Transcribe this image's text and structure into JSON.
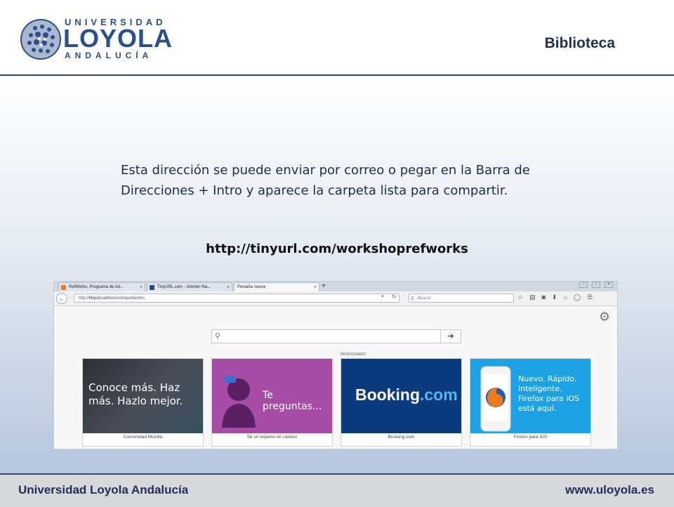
{
  "header": {
    "logo": {
      "line1": "UNIVERSIDAD",
      "line2": "LOYOLA",
      "line3": "ANDALUCÍA"
    },
    "section_title": "Biblioteca"
  },
  "main": {
    "body_text": "Esta dirección se puede enviar por correo o  pegar en la Barra de Direcciones + Intro y aparece la carpeta lista para compartir.",
    "url_text": "http://tinyurl.com/workshoprefworks"
  },
  "browser": {
    "tabs": [
      {
        "label": "RefWorks, Programa de Ad...",
        "favicon": "refworks-icon",
        "color": "#e27b2d"
      },
      {
        "label": "TinyURL.com - shorten tha...",
        "favicon": "tinyurl-icon",
        "color": "#2b4a8a"
      },
      {
        "label": "Pestaña nueva",
        "favicon": "",
        "color": "#f7f7f7"
      }
    ],
    "tab_close": "×",
    "new_tab": "+",
    "address": {
      "prefix": "http://",
      "domain": "tinyurl.com",
      "path": "/workshoprefworks"
    },
    "search_placeholder": "Buscar",
    "toolbar_icons": [
      "star-icon",
      "reading-list-icon",
      "pocket-icon",
      "download-icon",
      "home-icon",
      "chat-icon",
      "menu-icon"
    ],
    "newtab": {
      "sponsored_label": "PATROCINADO",
      "tiles": [
        {
          "label": "Comunidad Mozilla",
          "thumb_text": "Conoce más. Haz más. Hazlo mejor.",
          "bg": "#3a3d45"
        },
        {
          "label": "Sé un experto en rastreo",
          "thumb_text": "Te preguntas...",
          "bg": "#a64ca6"
        },
        {
          "label": "Booking.com",
          "thumb_text": "Booking",
          "thumb_text2": ".com",
          "bg": "#0b3a7e"
        },
        {
          "label": "Firefox para iOS",
          "thumb_text": "Nuevo. Rápido. Inteligente. Firefox para iOS está aquí.",
          "bg": "#1ea1e3"
        }
      ]
    }
  },
  "footer": {
    "left": "Universidad Loyola Andalucía",
    "right": "www.uloyola.es"
  },
  "colors": {
    "brand": "#2a4f8a",
    "title": "#1f2f5a"
  }
}
